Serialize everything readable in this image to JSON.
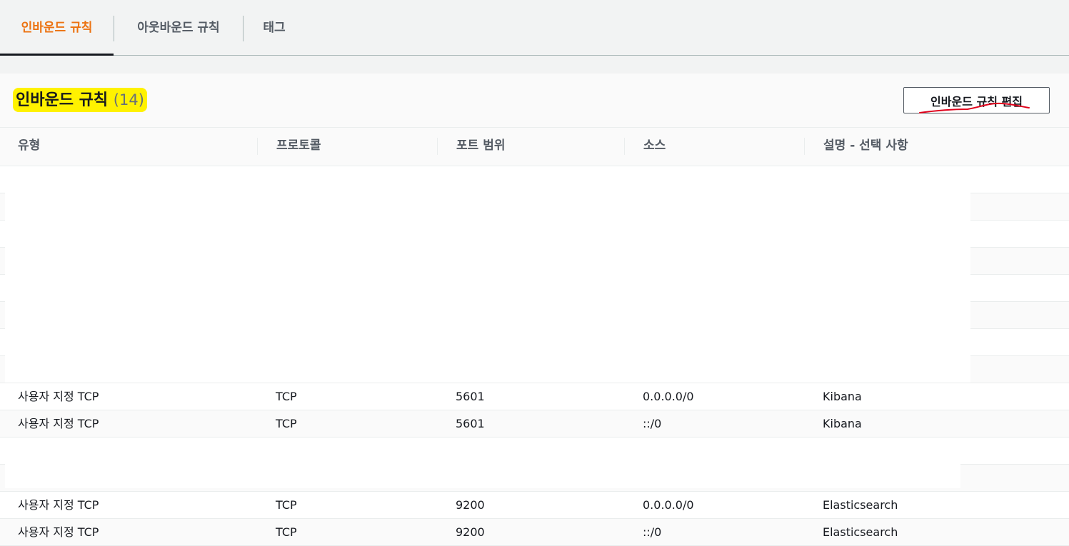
{
  "tabs": [
    {
      "label": "인바운드 규칙",
      "active": true
    },
    {
      "label": "아웃바운드 규칙",
      "active": false
    },
    {
      "label": "태그",
      "active": false
    }
  ],
  "panel": {
    "title": "인바운드 규칙",
    "count": "(14)",
    "edit_button": "인바운드 규칙 편집"
  },
  "table": {
    "headers": [
      "유형",
      "프로토콜",
      "포트 범위",
      "소스",
      "설명 - 선택 사항"
    ],
    "rows": [
      {
        "type": "사용자 지정 TCP",
        "protocol": "TCP",
        "port": "5601",
        "source": "0.0.0.0/0",
        "description": "Kibana"
      },
      {
        "type": "사용자 지정 TCP",
        "protocol": "TCP",
        "port": "5601",
        "source": "::/0",
        "description": "Kibana"
      },
      {
        "type": "사용자 지정 TCP",
        "protocol": "TCP",
        "port": "9200",
        "source": "0.0.0.0/0",
        "description": "Elasticsearch"
      },
      {
        "type": "사용자 지정 TCP",
        "protocol": "TCP",
        "port": "9200",
        "source": "::/0",
        "description": "Elasticsearch"
      }
    ]
  },
  "colors": {
    "active_tab": "#ec7211",
    "highlight": "#fff200",
    "annotation": "#e0001b"
  }
}
